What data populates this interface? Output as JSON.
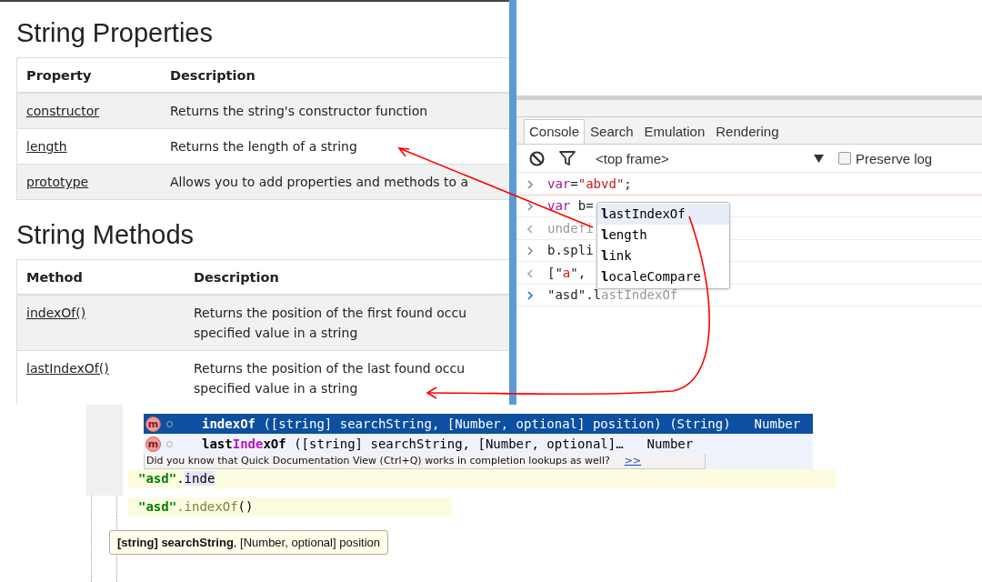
{
  "web_page": {
    "sections": [
      {
        "heading": "String Properties",
        "columns": [
          "Property",
          "Description"
        ],
        "rows": [
          {
            "name": "constructor",
            "description": "Returns the string's constructor function"
          },
          {
            "name": "length",
            "description": "Returns the length of a string"
          },
          {
            "name": "prototype",
            "description": "Allows you to add properties and methods to a"
          }
        ]
      },
      {
        "heading": "String Methods",
        "columns": [
          "Method",
          "Description"
        ],
        "rows": [
          {
            "name": "indexOf()",
            "description": "Returns the position of the first found occu",
            "description_2": "specified value in a string"
          },
          {
            "name": "lastIndexOf()",
            "description": "Returns the position of the last found occu",
            "description_2": "specified value in a string"
          }
        ]
      }
    ]
  },
  "devtools": {
    "tabs": [
      {
        "label": "Console",
        "selected": true
      },
      {
        "label": "Search",
        "selected": false
      },
      {
        "label": "Emulation",
        "selected": false
      },
      {
        "label": "Rendering",
        "selected": false
      }
    ],
    "frame_selector": "<top frame>",
    "preserve_log": {
      "label": "Preserve log",
      "checked": false
    },
    "console_lines": [
      {
        "kind": "input",
        "parts": [
          {
            "kind": "keyword",
            "text": "var"
          },
          {
            "kind": "plain",
            "text": "="
          },
          {
            "kind": "string",
            "text": "\"abvd\""
          },
          {
            "kind": "plain",
            "text": ";"
          }
        ]
      },
      {
        "kind": "input",
        "parts": [
          {
            "kind": "keyword",
            "text": "var"
          },
          {
            "kind": "plain",
            "text": " b="
          }
        ]
      },
      {
        "kind": "output",
        "parts": [
          {
            "kind": "muted",
            "text": "undefi"
          }
        ]
      },
      {
        "kind": "input",
        "parts": [
          {
            "kind": "plain",
            "text": "b.spli"
          }
        ]
      },
      {
        "kind": "output",
        "parts": [
          {
            "kind": "plain",
            "text": "[\""
          },
          {
            "kind": "string",
            "text": "a"
          },
          {
            "kind": "plain",
            "text": "\","
          }
        ]
      },
      {
        "kind": "prompt",
        "parts": [
          {
            "kind": "plain",
            "text": "\"asd\".l"
          },
          {
            "kind": "muted",
            "text": "astIndexOf"
          }
        ]
      }
    ],
    "suggestions": [
      {
        "label": "**l**astIndexOf",
        "selected": true
      },
      {
        "label": "**l**ength",
        "selected": false
      },
      {
        "label": "**l**ink",
        "selected": false
      },
      {
        "label": "**l**ocaleCompare",
        "selected": false
      }
    ]
  },
  "ide": {
    "completions": [
      {
        "icon": "m",
        "match": "indexOf",
        "params": "([string] searchString, [Number, optional] position)",
        "owner": "(String)",
        "return_type": "Number",
        "selected": true
      },
      {
        "icon": "m",
        "before": "last",
        "match": "Inde",
        "after": "xOf",
        "params": "([string] searchString, [Number, optional]…",
        "return_type": "Number",
        "selected": false
      }
    ],
    "tip": {
      "text": "Did you know that Quick Documentation View (Ctrl+Q) works in completion lookups as well?",
      "link": ">>"
    },
    "code_lines": [
      [
        {
          "kind": "string",
          "text": "\"asd\""
        },
        {
          "kind": "plain",
          "text": "."
        },
        {
          "kind": "typed",
          "text": "inde"
        }
      ],
      [
        {
          "kind": "string",
          "text": "\"asd\""
        },
        {
          "kind": "method",
          "text": ".indexOf"
        },
        {
          "kind": "plain",
          "text": "()"
        }
      ]
    ],
    "parameter_info": "**[string] searchString**, [Number, optional] position"
  }
}
